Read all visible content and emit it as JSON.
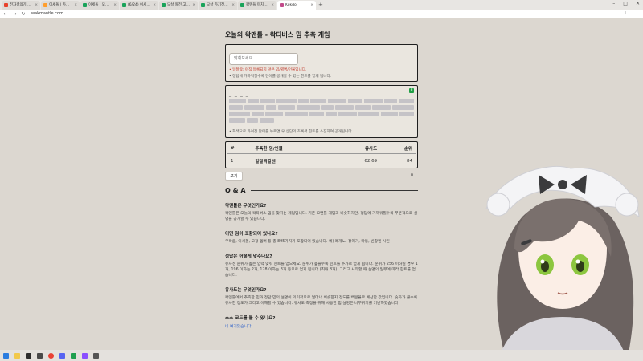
{
  "browser": {
    "tabs": [
      {
        "label": "전자결의기 꼬매들 · 종합 가시기",
        "active": false,
        "color": "#e8412c"
      },
      {
        "label": "이세돌 | 카파가시코 페통들",
        "active": false,
        "color": "#ff9e2c"
      },
      {
        "label": "이세돌 | 모팡 비티오 펙통들 · 오",
        "active": false,
        "color": "#1aa35a"
      },
      {
        "label": "(6/24) 이세돌 팡실팡실 일 · 비디",
        "active": false,
        "color": "#1aa35a"
      },
      {
        "label": "모살 왕전 고리용 촉영별 끝마니",
        "active": false,
        "color": "#1aa35a"
      },
      {
        "label": "모살 가기전에 쪽밴들 한 번 해",
        "active": false,
        "color": "#1aa35a"
      },
      {
        "label": "꽉맨들 마치에 비터버스 · 비드",
        "active": false,
        "color": "#1aa35a"
      },
      {
        "label": "Kokdo",
        "active": true,
        "color": "#c24a8a"
      }
    ],
    "new_tab": "+",
    "url": "wakmantle.com",
    "nav": {
      "back": "←",
      "forward": "→",
      "reload": "↻"
    }
  },
  "page": {
    "title": "오늘의 왁맨틀 - 왁타버스 밈 추측 게임",
    "input_placeholder": "맞춰보세요",
    "error_msg": "• 알잘딱: 아직 등록되지 않은 밈/별명/인물입니다.",
    "input_note": "• 정답에 가까워질수록 단어를 공개할 수 있는 힌트를 얻게 됩니다.",
    "hint": {
      "dashes": "_ _ _ _",
      "badge": "8",
      "footer": "• 회색으로 가려진 단어를 누르면 우 상단의 초록색 힌트를 소진하여 공개됩니다."
    },
    "table": {
      "headers": [
        "#",
        "추측한 밈/인물",
        "유사도",
        "순위"
      ],
      "rows": [
        {
          "num": "1",
          "word": "알잘딱깔센",
          "similarity": "62.69",
          "rank": "84"
        }
      ]
    },
    "give_up": "포기",
    "guess_count": "0",
    "qa": {
      "title": "Q & A",
      "items": [
        {
          "q": "왁맨틀은 무엇인가요?",
          "a": "왁맨틀은 오늘의 왁타버스 밈을 맞히는 게임입니다. 기존 꼬맨틀 게임과 비슷하지만, 정답에 가까워질수록 부분적으로 설명을 공개할 수 있습니다."
        },
        {
          "q": "어떤 밈이 포함되어 있나요?",
          "a": "우왁굳, 이세돌, 고정 멤버 등 총 895가지가 포함되어 있습니다. 예) 레게노, 정여기, 마동, 빈창렌 시민"
        },
        {
          "q": "정답은 어떻게 맞추나요?",
          "a": "유사성 순위가 높은 입력 맞춰 힌트를 얻으세요. 순위가 높을수록 힌트를 추가로 얻게 됩니다. 순위가 256 이하일 경우 1개, 196 이하는 2개, 128 이하는 3개 등으로 얻게 됩니다 (최대 8개). 그리고 시작할 때 설명의 일부에 따라 힌트를 얻습니다."
        },
        {
          "q": "유사도는 무엇인가요?",
          "a": "왁맨틀에서 추측한 밈과 정답 밈의 설명이 의미적으로 얼마나 비슷한지 정도를 백분율로 계산한 값입니다. 숫자가 클수록 유사한 정도가 크다고 이해할 수 있습니다. 유사도 측정을 위해 사용한 밈 설명은 나무위키를 기반하였습니다."
        },
        {
          "q": "소스 코드를 볼 수 있나요?",
          "a": "",
          "link": "네 여기있습니다."
        }
      ]
    }
  },
  "colors": {
    "page_bg": "#dcd7d0",
    "box_bg": "#eae6df",
    "error_red": "#c0392b",
    "link_blue": "#2f62c9",
    "hint_green": "#22a046"
  }
}
